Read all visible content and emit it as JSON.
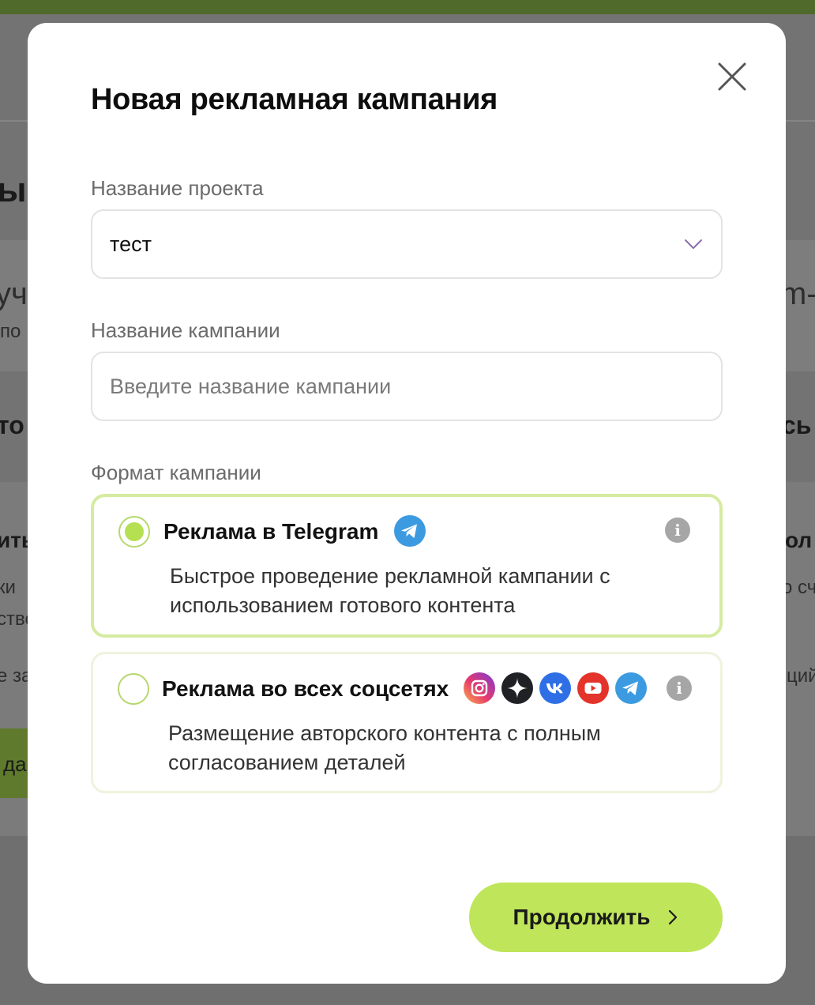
{
  "background": {
    "fragments": [
      "ы",
      "уч",
      "по",
      "m-",
      "то",
      "сь",
      "ить",
      "ол",
      "ки",
      "о сч",
      "ство",
      "е за",
      "ций",
      "да"
    ]
  },
  "modal": {
    "title": "Новая рекламная кампания",
    "close_icon": "close-icon",
    "project": {
      "label": "Название проекта",
      "value": "тест",
      "icon": "chevron-down-icon"
    },
    "campaign": {
      "label": "Название кампании",
      "placeholder": "Введите название кампании",
      "value": ""
    },
    "format": {
      "label": "Формат кампании",
      "options": [
        {
          "title": "Реклама в Telegram",
          "description": "Быстрое проведение рекламной кампании с использованием готового контента",
          "selected": true,
          "icons": [
            "telegram-icon"
          ]
        },
        {
          "title": "Реклама во всех соцсетях",
          "description": "Размещение авторского контента с полным согласованием деталей",
          "selected": false,
          "icons": [
            "instagram-icon",
            "dzen-icon",
            "vk-icon",
            "youtube-icon",
            "telegram-icon"
          ]
        }
      ]
    },
    "continue_label": "Продолжить"
  },
  "colors": {
    "accent": "#bfe55a",
    "radio_selected": "#b5e052",
    "telegram": "#3c9be0",
    "vk": "#2f6fe6",
    "youtube": "#e4332a",
    "dzen": "#202124",
    "overlay": "#737373"
  }
}
